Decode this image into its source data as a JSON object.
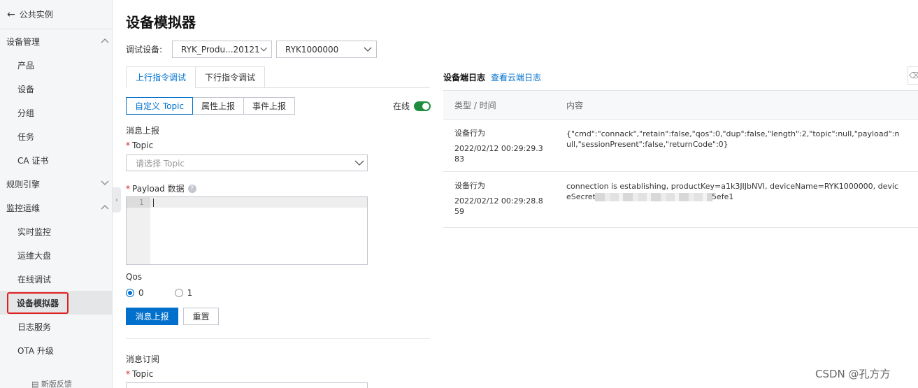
{
  "sidebar": {
    "back_label": "公共实例",
    "groups": [
      {
        "label": "设备管理"
      },
      {
        "label": "规则引擎"
      },
      {
        "label": "监控运维"
      }
    ],
    "items_device": [
      "产品",
      "设备",
      "分组",
      "任务",
      "CA 证书"
    ],
    "items_monitor": [
      "实时监控",
      "运维大盘",
      "在线调试",
      "设备模拟器",
      "日志服务",
      "OTA 升级"
    ],
    "footer": "新版反馈"
  },
  "page": {
    "title": "设备模拟器",
    "device_label": "调试设备:",
    "product_select": "RYK_Produ...20121",
    "device_select": "RYK1000000"
  },
  "tabs": [
    "上行指令调试",
    "下行指令调试"
  ],
  "subtabs": [
    "自定义 Topic",
    "属性上报",
    "事件上报"
  ],
  "online_label": "在线",
  "publish": {
    "section_title": "消息上报",
    "topic_label": "Topic",
    "topic_placeholder": "请选择 Topic",
    "payload_label": "Payload 数据",
    "line_number": "1",
    "qos_label": "Qos",
    "qos_options": [
      "0",
      "1"
    ],
    "submit_label": "消息上报",
    "reset_label": "重置"
  },
  "subscribe": {
    "section_title": "消息订阅",
    "topic_label": "Topic"
  },
  "log": {
    "title": "设备端日志",
    "cloud_link": "查看云端日志",
    "col_type_time": "类型 / 时间",
    "col_content": "内容",
    "rows": [
      {
        "type": "设备行为",
        "time": "2022/02/12 00:29:29.383",
        "content": "{\"cmd\":\"connack\",\"retain\":false,\"qos\":0,\"dup\":false,\"length\":2,\"topic\":null,\"payload\":null,\"sessionPresent\":false,\"returnCode\":0}"
      },
      {
        "type": "设备行为",
        "time": "2022/02/12 00:29:28.859",
        "content_pre": "connection is establishing, productKey=a1k3JIJbNVI, deviceName=RYK1000000, deviceSecret",
        "content_post": "5efe1"
      }
    ]
  },
  "watermark": "CSDN @孔方方",
  "colors": {
    "primary": "#0070cc",
    "highlight": "#e02020",
    "toggle": "#1e8e3e"
  }
}
